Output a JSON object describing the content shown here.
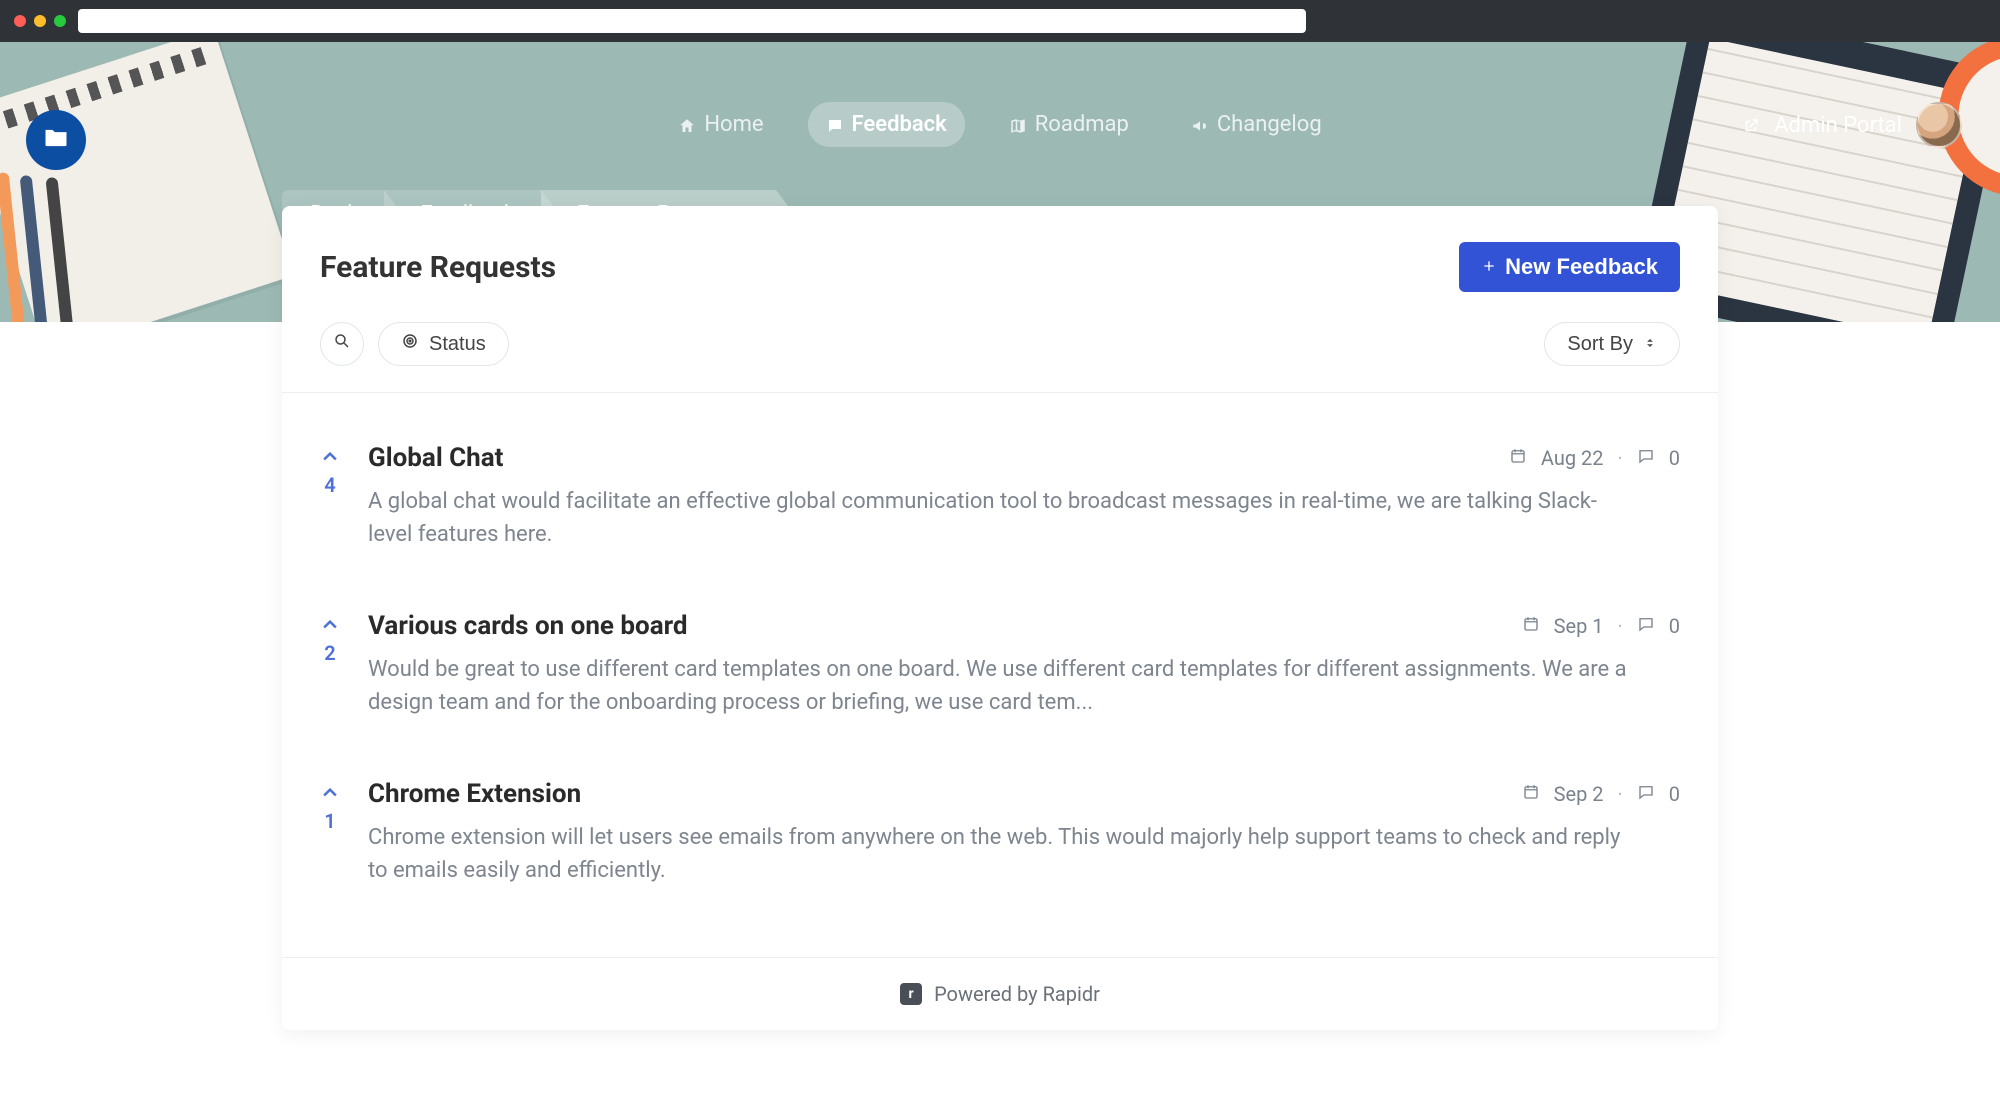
{
  "nav": {
    "home": "Home",
    "feedback": "Feedback",
    "roadmap": "Roadmap",
    "changelog": "Changelog",
    "admin_portal": "Admin Portal"
  },
  "breadcrumb": {
    "back": "Back",
    "feedback": "Feedback",
    "current": "Feature Requests"
  },
  "page": {
    "title": "Feature Requests",
    "new_feedback": "New Feedback"
  },
  "filters": {
    "status": "Status",
    "sort_by": "Sort By"
  },
  "items": [
    {
      "votes": "4",
      "title": "Global Chat",
      "date": "Aug 22",
      "comments": "0",
      "desc": "A global chat would facilitate an effective global communication tool to broadcast messages in real-time, we are talking Slack-level features here."
    },
    {
      "votes": "2",
      "title": "Various cards on one board",
      "date": "Sep 1",
      "comments": "0",
      "desc": "Would be great to use different card templates on one board. We use different card templates for different assignments. We are a design team and for the onboarding process or briefing, we use card tem..."
    },
    {
      "votes": "1",
      "title": "Chrome Extension",
      "date": "Sep 2",
      "comments": "0",
      "desc": "Chrome extension will let users see emails from anywhere on the web. This would majorly help support teams to check and reply to emails easily and efficiently."
    }
  ],
  "footer": {
    "powered": "Powered by Rapidr",
    "badge": "r"
  }
}
